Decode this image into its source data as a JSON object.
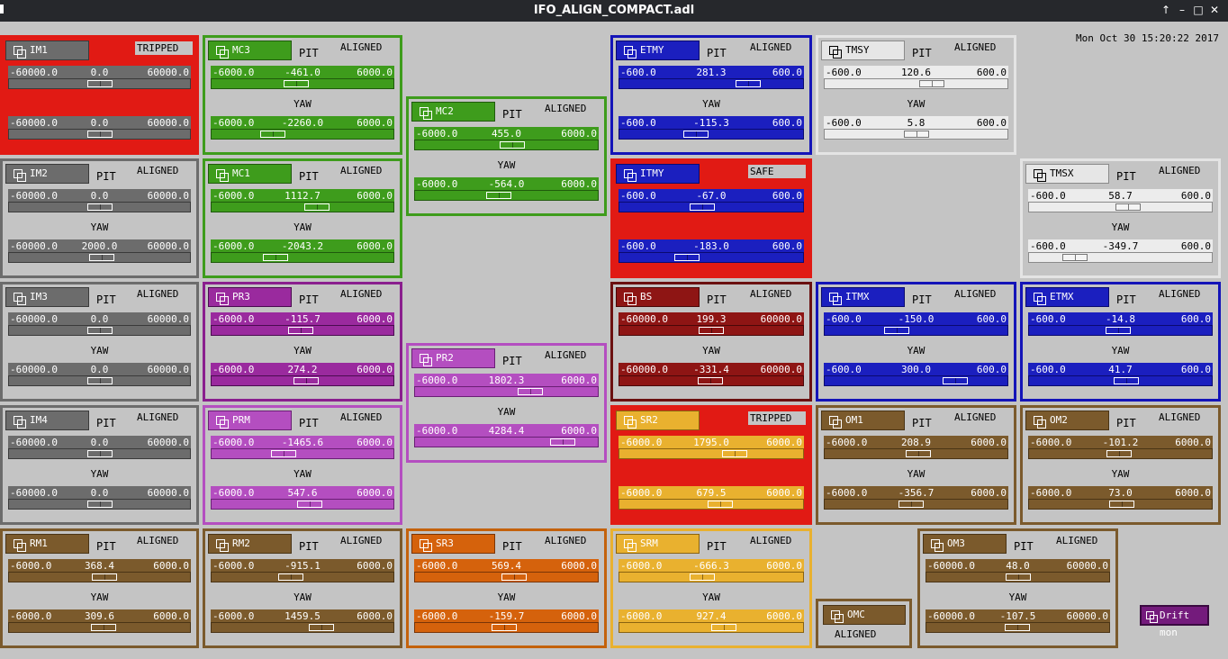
{
  "window": {
    "title": "IFO_ALIGN_COMPACT.adl"
  },
  "clock": "Mon Oct 30 15:20:22 2017",
  "labels": {
    "pit": "PIT",
    "yaw": "YAW"
  },
  "drift_button": "Drift mon",
  "omc": {
    "name": "OMC",
    "status": "ALIGNED"
  },
  "colors": {
    "red": "#e11a14",
    "gray": "#6c6c6c",
    "light": "#dcdcdc",
    "green": "#3e9c1c",
    "purple": "#9a2a9e",
    "violet": "#b44ec0",
    "blue": "#1b1fbf",
    "darkred": "#8e1514",
    "brown": "#7b5a2c",
    "orange": "#d5620c",
    "yellow": "#e9b12f"
  },
  "panels": [
    {
      "name": "IM1",
      "status": "TRIPPED",
      "tripped": true,
      "pitch": {
        "lo": "-60000.0",
        "val": "0.0",
        "hi": "60000.0",
        "pos": 0.5
      },
      "yaw": {
        "lo": "-60000.0",
        "val": "0.0",
        "hi": "60000.0",
        "pos": 0.5
      }
    },
    {
      "name": "IM2",
      "status": "ALIGNED",
      "pitch": {
        "lo": "-60000.0",
        "val": "0.0",
        "hi": "60000.0",
        "pos": 0.5
      },
      "yaw": {
        "lo": "-60000.0",
        "val": "2000.0",
        "hi": "60000.0",
        "pos": 0.517
      }
    },
    {
      "name": "IM3",
      "status": "ALIGNED",
      "pitch": {
        "lo": "-60000.0",
        "val": "0.0",
        "hi": "60000.0",
        "pos": 0.5
      },
      "yaw": {
        "lo": "-60000.0",
        "val": "0.0",
        "hi": "60000.0",
        "pos": 0.5
      }
    },
    {
      "name": "IM4",
      "status": "ALIGNED",
      "pitch": {
        "lo": "-60000.0",
        "val": "0.0",
        "hi": "60000.0",
        "pos": 0.5
      },
      "yaw": {
        "lo": "-60000.0",
        "val": "0.0",
        "hi": "60000.0",
        "pos": 0.5
      }
    },
    {
      "name": "RM1",
      "status": "ALIGNED",
      "pitch": {
        "lo": "-6000.0",
        "val": "368.4",
        "hi": "6000.0",
        "pos": 0.531
      },
      "yaw": {
        "lo": "-6000.0",
        "val": "309.6",
        "hi": "6000.0",
        "pos": 0.526
      }
    },
    {
      "name": "MC3",
      "status": "ALIGNED",
      "pitch": {
        "lo": "-6000.0",
        "val": "-461.0",
        "hi": "6000.0",
        "pos": 0.462
      },
      "yaw": {
        "lo": "-6000.0",
        "val": "-2260.0",
        "hi": "6000.0",
        "pos": 0.312
      }
    },
    {
      "name": "MC1",
      "status": "ALIGNED",
      "pitch": {
        "lo": "-6000.0",
        "val": "1112.7",
        "hi": "6000.0",
        "pos": 0.593
      },
      "yaw": {
        "lo": "-6000.0",
        "val": "-2043.2",
        "hi": "6000.0",
        "pos": 0.33
      }
    },
    {
      "name": "PR3",
      "status": "ALIGNED",
      "pitch": {
        "lo": "-6000.0",
        "val": "-115.7",
        "hi": "6000.0",
        "pos": 0.49
      },
      "yaw": {
        "lo": "-6000.0",
        "val": "274.2",
        "hi": "6000.0",
        "pos": 0.523
      }
    },
    {
      "name": "PRM",
      "status": "ALIGNED",
      "pitch": {
        "lo": "-6000.0",
        "val": "-1465.6",
        "hi": "6000.0",
        "pos": 0.378
      },
      "yaw": {
        "lo": "-6000.0",
        "val": "547.6",
        "hi": "6000.0",
        "pos": 0.546
      }
    },
    {
      "name": "RM2",
      "status": "ALIGNED",
      "pitch": {
        "lo": "-6000.0",
        "val": "-915.1",
        "hi": "6000.0",
        "pos": 0.424
      },
      "yaw": {
        "lo": "-6000.0",
        "val": "1459.5",
        "hi": "6000.0",
        "pos": 0.622
      }
    },
    {
      "name": "MC2",
      "status": "ALIGNED",
      "pitch": {
        "lo": "-6000.0",
        "val": "455.0",
        "hi": "6000.0",
        "pos": 0.538
      },
      "yaw": {
        "lo": "-6000.0",
        "val": "-564.0",
        "hi": "6000.0",
        "pos": 0.453
      }
    },
    {
      "name": "PR2",
      "status": "ALIGNED",
      "pitch": {
        "lo": "-6000.0",
        "val": "1802.3",
        "hi": "6000.0",
        "pos": 0.65
      },
      "yaw": {
        "lo": "-6000.0",
        "val": "4284.4",
        "hi": "6000.0",
        "pos": 0.857
      }
    },
    {
      "name": "SR3",
      "status": "ALIGNED",
      "pitch": {
        "lo": "-6000.0",
        "val": "569.4",
        "hi": "6000.0",
        "pos": 0.547
      },
      "yaw": {
        "lo": "-6000.0",
        "val": "-159.7",
        "hi": "6000.0",
        "pos": 0.487
      }
    },
    {
      "name": "ETMY",
      "status": "ALIGNED",
      "pitch": {
        "lo": "-600.0",
        "val": "281.3",
        "hi": "600.0",
        "pos": 0.734
      },
      "yaw": {
        "lo": "-600.0",
        "val": "-115.3",
        "hi": "600.0",
        "pos": 0.404
      }
    },
    {
      "name": "ITMY",
      "status": "SAFE",
      "tripped": true,
      "pitch": {
        "lo": "-600.0",
        "val": "-67.0",
        "hi": "600.0",
        "pos": 0.444
      },
      "yaw": {
        "lo": "-600.0",
        "val": "-183.0",
        "hi": "600.0",
        "pos": 0.348
      }
    },
    {
      "name": "BS",
      "status": "ALIGNED",
      "pitch": {
        "lo": "-60000.0",
        "val": "199.3",
        "hi": "60000.0",
        "pos": 0.502
      },
      "yaw": {
        "lo": "-60000.0",
        "val": "-331.4",
        "hi": "60000.0",
        "pos": 0.497
      }
    },
    {
      "name": "SR2",
      "status": "TRIPPED",
      "tripped": true,
      "pitch": {
        "lo": "-6000.0",
        "val": "1795.0",
        "hi": "6000.0",
        "pos": 0.65
      },
      "yaw": {
        "lo": "-6000.0",
        "val": "679.5",
        "hi": "6000.0",
        "pos": 0.557
      }
    },
    {
      "name": "SRM",
      "status": "ALIGNED",
      "pitch": {
        "lo": "-6000.0",
        "val": "-666.3",
        "hi": "6000.0",
        "pos": 0.444
      },
      "yaw": {
        "lo": "-6000.0",
        "val": "927.4",
        "hi": "6000.0",
        "pos": 0.577
      }
    },
    {
      "name": "TMSY",
      "status": "ALIGNED",
      "pitch": {
        "lo": "-600.0",
        "val": "120.6",
        "hi": "600.0",
        "pos": 0.6
      },
      "yaw": {
        "lo": "-600.0",
        "val": "5.8",
        "hi": "600.0",
        "pos": 0.505
      }
    },
    {
      "name": "ITMX",
      "status": "ALIGNED",
      "pitch": {
        "lo": "-600.0",
        "val": "-150.0",
        "hi": "600.0",
        "pos": 0.375
      },
      "yaw": {
        "lo": "-600.0",
        "val": "300.0",
        "hi": "600.0",
        "pos": 0.75
      }
    },
    {
      "name": "OM1",
      "status": "ALIGNED",
      "pitch": {
        "lo": "-6000.0",
        "val": "208.9",
        "hi": "6000.0",
        "pos": 0.517
      },
      "yaw": {
        "lo": "-6000.0",
        "val": "-356.7",
        "hi": "6000.0",
        "pos": 0.47
      }
    },
    {
      "name": "TMSX",
      "status": "ALIGNED",
      "pitch": {
        "lo": "-600.0",
        "val": "58.7",
        "hi": "600.0",
        "pos": 0.549
      },
      "yaw": {
        "lo": "-600.0",
        "val": "-349.7",
        "hi": "600.0",
        "pos": 0.209
      }
    },
    {
      "name": "ETMX",
      "status": "ALIGNED",
      "pitch": {
        "lo": "-600.0",
        "val": "-14.8",
        "hi": "600.0",
        "pos": 0.488
      },
      "yaw": {
        "lo": "-600.0",
        "val": "41.7",
        "hi": "600.0",
        "pos": 0.535
      }
    },
    {
      "name": "OM2",
      "status": "ALIGNED",
      "pitch": {
        "lo": "-6000.0",
        "val": "-101.2",
        "hi": "6000.0",
        "pos": 0.492
      },
      "yaw": {
        "lo": "-6000.0",
        "val": "73.0",
        "hi": "6000.0",
        "pos": 0.506
      }
    },
    {
      "name": "OM3",
      "status": "ALIGNED",
      "pitch": {
        "lo": "-60000.0",
        "val": "48.0",
        "hi": "60000.0",
        "pos": 0.5
      },
      "yaw": {
        "lo": "-60000.0",
        "val": "-107.5",
        "hi": "60000.0",
        "pos": 0.499
      }
    }
  ]
}
